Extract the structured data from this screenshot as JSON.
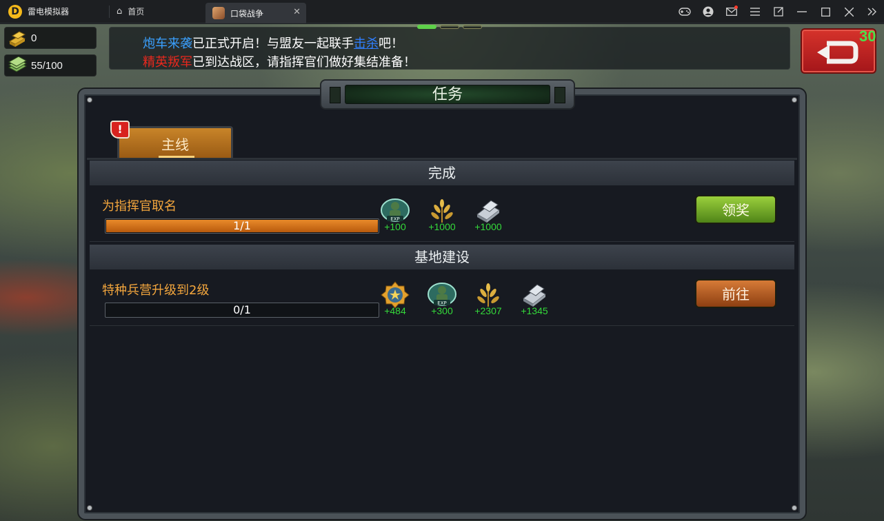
{
  "emulator": {
    "app_name": "雷电模拟器",
    "tabs": [
      {
        "label": "首页"
      },
      {
        "label": "口袋战争"
      }
    ]
  },
  "resources": {
    "gold": "0",
    "energy": "55/100"
  },
  "notice": {
    "line1": {
      "hl": "炮车来袭",
      "mid": "已正式开启！与盟友一起联手",
      "link": "击杀",
      "end": "吧！"
    },
    "line2": {
      "hl": "精英叛军",
      "rest": "已到达战区，请指挥官们做好集结准备！"
    }
  },
  "fps": "30",
  "panel": {
    "title": "任务",
    "tab_label": "主线",
    "tab_alert": "!",
    "sections": [
      {
        "header": "完成",
        "task": {
          "name": "为指挥官取名",
          "progress_text": "1/1",
          "progress": 1.0,
          "rewards": [
            {
              "icon": "exp-badge-icon",
              "value": "+100"
            },
            {
              "icon": "wheat-food-icon",
              "value": "+1000"
            },
            {
              "icon": "steel-ingot-icon",
              "value": "+1000"
            }
          ],
          "button": "领奖"
        }
      },
      {
        "header": "基地建设",
        "task": {
          "name": "特种兵营升级到2级",
          "progress_text": "0/1",
          "progress": 0.0,
          "rewards": [
            {
              "icon": "star-medal-icon",
              "value": "+484"
            },
            {
              "icon": "exp-badge-icon",
              "value": "+300"
            },
            {
              "icon": "wheat-food-icon",
              "value": "+2307"
            },
            {
              "icon": "steel-ingot-icon",
              "value": "+1345"
            }
          ],
          "button": "前往"
        }
      }
    ]
  },
  "colors": {
    "accent_orange": "#f3a63d",
    "reward_green": "#34d93a",
    "claim_green": "#7bb52c",
    "go_brown": "#b8602a"
  }
}
